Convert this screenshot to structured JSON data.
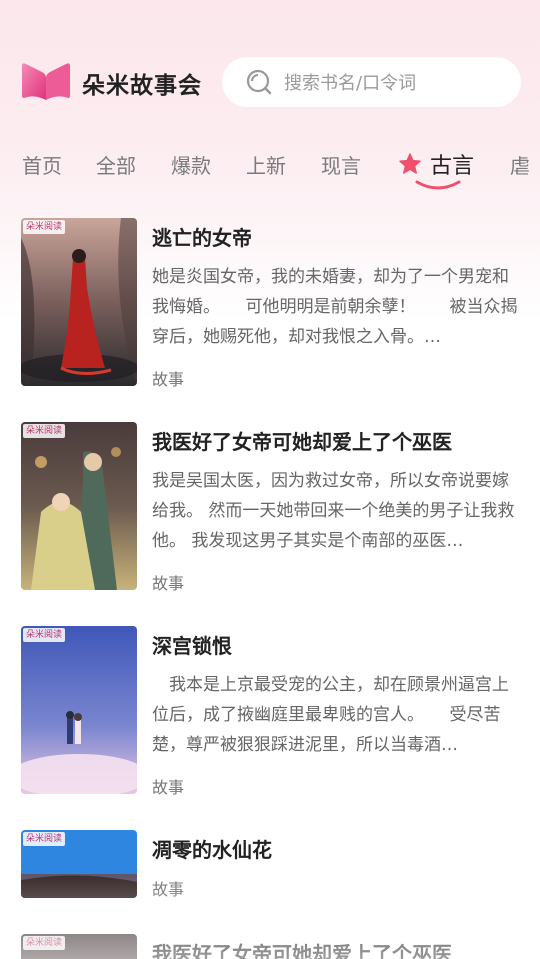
{
  "app": {
    "name": "朵米故事会"
  },
  "search": {
    "placeholder": "搜索书名/口令词"
  },
  "tabs": [
    {
      "label": "首页"
    },
    {
      "label": "全部"
    },
    {
      "label": "爆款"
    },
    {
      "label": "上新"
    },
    {
      "label": "现言"
    },
    {
      "label": "古言",
      "active": true
    },
    {
      "label": "虐"
    }
  ],
  "books": [
    {
      "title": "逃亡的女帝",
      "desc": "她是炎国女帝，我的未婚妻，却为了一个男宠和我悔婚。　　可他明明是前朝余孽！　　被当众揭穿后，她赐死他，却对我恨之入骨。…",
      "tag": "故事",
      "badge": "朵米阅读"
    },
    {
      "title": "我医好了女帝可她却爱上了个巫医",
      "desc": "我是吴国太医，因为救过女帝，所以女帝说要嫁给我。 然而一天她带回来一个绝美的男子让我救他。 我发现这男子其实是个南部的巫医…",
      "tag": "故事",
      "badge": "朵米阅读"
    },
    {
      "title": "深宫锁恨",
      "desc": "　我本是上京最受宠的公主，却在顾景州逼宫上位后，成了掖幽庭里最卑贱的宫人。　　受尽苦楚，尊严被狠狠踩进泥里，所以当毒酒…",
      "tag": "故事",
      "badge": "朵米阅读"
    },
    {
      "title": "凋零的水仙花",
      "desc": "",
      "tag": "故事",
      "badge": "朵米阅读"
    },
    {
      "title": "我医好了女帝可她却爱上了个巫医",
      "desc": "",
      "tag": "",
      "badge": "朵米阅读"
    }
  ],
  "colors": {
    "accent": "#e64a86",
    "star": "#f0506e",
    "bg_top": "#fbe7ec"
  }
}
